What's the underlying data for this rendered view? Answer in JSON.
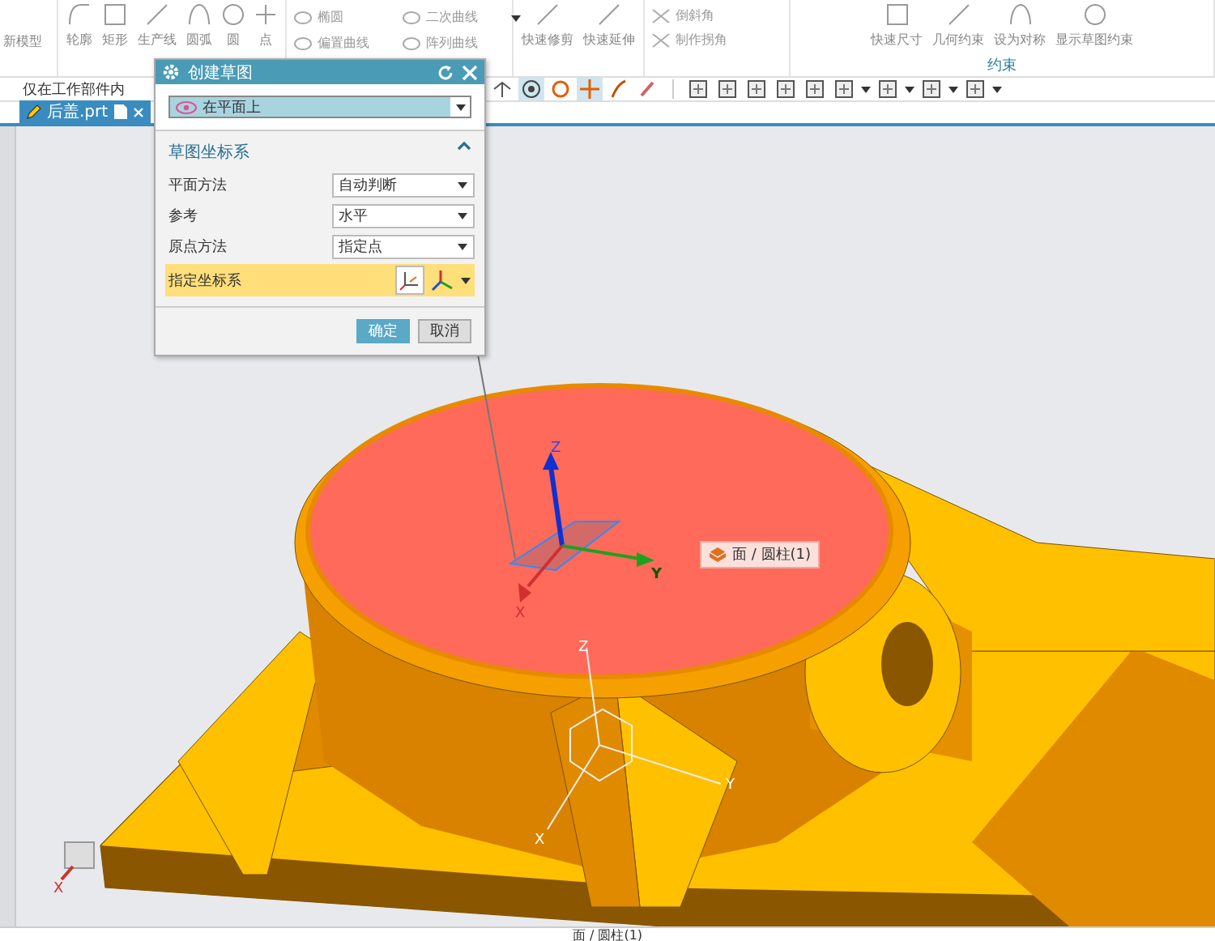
{
  "ribbon": {
    "left_cut": "新模型",
    "sketch_tools": [
      "轮廓",
      "矩形",
      "生产线",
      "圆弧",
      "圆",
      "点"
    ],
    "curve_items": [
      "椭圆",
      "二次曲线",
      "偏置曲线",
      "阵列曲线"
    ],
    "edit_tools": [
      "快速修剪",
      "快速延伸"
    ],
    "corner_items": [
      "倒斜角",
      "制作拐角"
    ],
    "constraint_tools": [
      "快速尺寸",
      "几何约束",
      "设为对称",
      "显示草图约束"
    ],
    "group_label": "约束"
  },
  "toolbar": {
    "filter": "仅在工作部件内"
  },
  "tabs": [
    {
      "label": "后盖.prt",
      "selected": true
    }
  ],
  "dialog": {
    "title": "创建草图",
    "type": "在平面上",
    "section": {
      "title": "草图坐标系",
      "expanded": true,
      "rows": [
        {
          "kind": "dropdown",
          "label": "平面方法",
          "value": "自动判断",
          "selected": false
        },
        {
          "kind": "dropdown",
          "label": "参考",
          "value": "水平",
          "selected": false
        },
        {
          "kind": "dropdown",
          "label": "原点方法",
          "value": "指定点",
          "selected": false
        },
        {
          "kind": "csys",
          "label": "指定坐标系",
          "selected": true
        }
      ]
    },
    "buttons": [
      {
        "kind": "primary",
        "label": "确定"
      },
      {
        "kind": "secondary",
        "label": "取消"
      }
    ]
  },
  "viewport": {
    "tooltip": "面 / 圆柱(1)",
    "sketch_axes": {
      "x": "X",
      "y": "Y",
      "z": "Z"
    },
    "csys_axes": {
      "x": "X",
      "y": "Y",
      "z": "Z"
    },
    "corner_axes": {
      "x": "X"
    }
  },
  "status_bar": {
    "text": "面 / 圆柱(1)"
  }
}
